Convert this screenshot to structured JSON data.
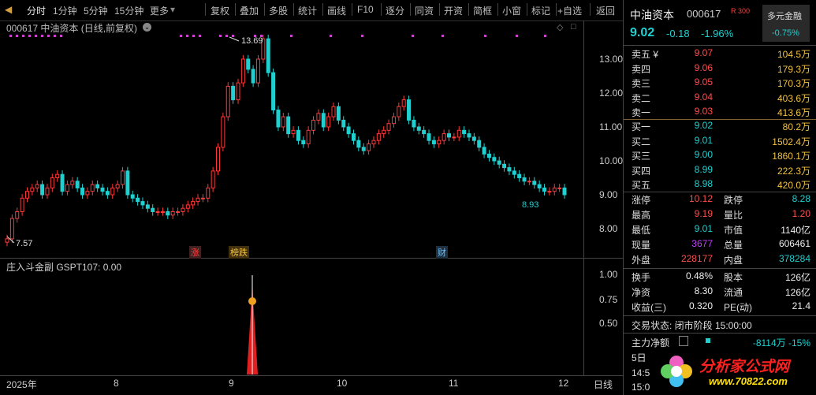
{
  "toolbar": {
    "tabs": [
      "分时",
      "1分钟",
      "5分钟",
      "15分钟",
      "更多"
    ],
    "tools": [
      "复权",
      "叠加",
      "多股",
      "统计",
      "画线",
      "F10",
      "逐分",
      "同资",
      "开资",
      "简框",
      "小窗",
      "标记",
      "+自选",
      "返回"
    ]
  },
  "chart_header": {
    "code_name": "000617 中油资本 (日线,前复权)"
  },
  "indicator": {
    "title": "庄入斗金副 GSPT107: 0.00",
    "yticks": [
      "1.00",
      "0.75",
      "0.50"
    ]
  },
  "chart_data": {
    "type": "candlestick",
    "yticks": [
      "13.00",
      "12.00",
      "11.00",
      "10.00",
      "9.00",
      "8.00"
    ],
    "xticks": [
      "2025年",
      "8",
      "9",
      "10",
      "11",
      "12"
    ],
    "x_end_label": "日线",
    "annotations": {
      "high": "13.69",
      "low": "7.57",
      "last_low": "8.93"
    },
    "event_tags": [
      "涨",
      "榜跌",
      "财"
    ],
    "ylim": [
      7.4,
      14.2
    ]
  },
  "right_panel": {
    "name": "中油资本",
    "code": "000617",
    "tag": "R 300",
    "badge": "多元金融",
    "price": "9.02",
    "change": "-0.18",
    "pct": "-1.96%",
    "badge_pct": "-0.75%",
    "asks": [
      {
        "label": "卖五 ¥",
        "price": "9.07",
        "vol": "104.5万"
      },
      {
        "label": "卖四",
        "price": "9.06",
        "vol": "179.3万"
      },
      {
        "label": "卖三",
        "price": "9.05",
        "vol": "170.3万"
      },
      {
        "label": "卖二",
        "price": "9.04",
        "vol": "403.6万"
      },
      {
        "label": "卖一",
        "price": "9.03",
        "vol": "413.6万"
      }
    ],
    "bids": [
      {
        "label": "买一",
        "price": "9.02",
        "vol": "80.2万"
      },
      {
        "label": "买二",
        "price": "9.01",
        "vol": "1502.4万"
      },
      {
        "label": "买三",
        "price": "9.00",
        "vol": "1860.1万"
      },
      {
        "label": "买四",
        "price": "8.99",
        "vol": "222.3万"
      },
      {
        "label": "买五",
        "price": "8.98",
        "vol": "420.0万"
      }
    ],
    "stats": [
      {
        "l1": "涨停",
        "v1": "10.12",
        "c1": "red",
        "l2": "跌停",
        "v2": "8.28",
        "c2": "green"
      },
      {
        "l1": "最高",
        "v1": "9.19",
        "c1": "red",
        "l2": "量比",
        "v2": "1.20",
        "c2": "red"
      },
      {
        "l1": "最低",
        "v1": "9.01",
        "c1": "green",
        "l2": "市值",
        "v2": "1140亿",
        "c2": "white"
      },
      {
        "l1": "现量",
        "v1": "3677",
        "c1": "purple",
        "l2": "总量",
        "v2": "606461",
        "c2": "white"
      },
      {
        "l1": "外盘",
        "v1": "228177",
        "c1": "red",
        "l2": "内盘",
        "v2": "378284",
        "c2": "green"
      }
    ],
    "stats2": [
      {
        "l1": "换手",
        "v1": "0.48%",
        "l2": "股本",
        "v2": "126亿"
      },
      {
        "l1": "净资",
        "v1": "8.30",
        "l2": "流通",
        "v2": "126亿"
      },
      {
        "l1": "收益(三)",
        "v1": "0.320",
        "l2": "PE(动)",
        "v2": "21.4"
      }
    ],
    "trade_status": "交易状态: 闭市阶段 15:00:00",
    "main_flow_label": "主力净额",
    "main_flow_value": "-8114万 -15%",
    "footer_date": "5日",
    "footer_time1": "14:5",
    "footer_time2": "15:0",
    "watermark": "分析家公式网",
    "watermark_url": "www.70822.com"
  }
}
